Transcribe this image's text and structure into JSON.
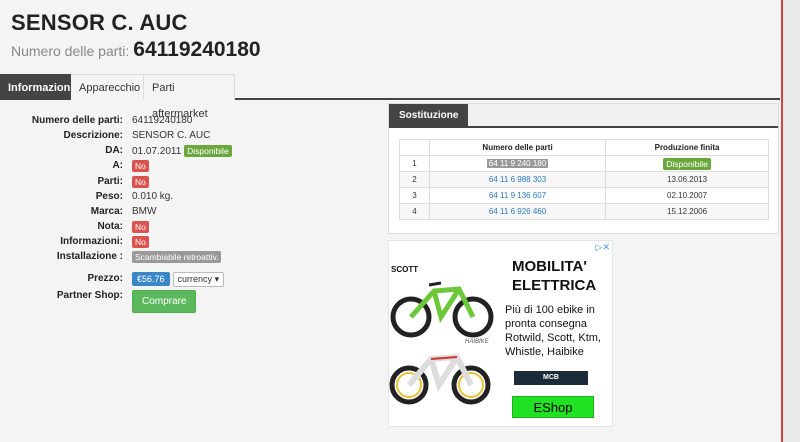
{
  "product": {
    "title": "SENSOR C. AUC",
    "subtitle_label": "Numero delle parti:",
    "subtitle_number": "64119240180"
  },
  "tabs": [
    {
      "label": "Informazioni",
      "active": true
    },
    {
      "label": "Apparecchio",
      "active": false
    },
    {
      "label": "Parti aftermarket",
      "active": false
    }
  ],
  "info": {
    "part_number": {
      "label": "Numero delle parti:",
      "value": "64119240180"
    },
    "description": {
      "label": "Descrizione:",
      "value": "SENSOR C. AUC"
    },
    "from": {
      "label": "DA:",
      "value": "01.07.2011",
      "badge": "Disponibile"
    },
    "a": {
      "label": "A:",
      "badge": "No"
    },
    "parts": {
      "label": "Parti:",
      "badge": "No"
    },
    "weight": {
      "label": "Peso:",
      "value": "0.010 kg."
    },
    "brand": {
      "label": "Marca:",
      "value": "BMW"
    },
    "note": {
      "label": "Nota:",
      "badge": "No"
    },
    "informazioni": {
      "label": "Informazioni:",
      "badge": "No"
    },
    "install": {
      "label": "Installazione :",
      "badge": "Scambiabile retroattiv."
    },
    "price": {
      "label": "Prezzo:",
      "value": "€56.76",
      "currency": "currency"
    },
    "partner": {
      "label": "Partner Shop:",
      "button": "Comprare"
    }
  },
  "substitution": {
    "tab": "Sostituzione",
    "headers": [
      "Numero delle parti",
      "Produzione finita"
    ],
    "rows": [
      {
        "idx": "1",
        "part": "64 11 9 240 180",
        "end": "Disponibile"
      },
      {
        "idx": "2",
        "part": "64 11 6 988 303",
        "end": "13.06.2013"
      },
      {
        "idx": "3",
        "part": "64 11 9 136 607",
        "end": "02.10.2007"
      },
      {
        "idx": "4",
        "part": "64 11 6 926 460",
        "end": "15.12.2006"
      }
    ]
  },
  "ad": {
    "close": "▷✕",
    "brand_top": "SCOTT",
    "brand_bottom": "HAIBIKE",
    "headline_1": "MOBILITA'",
    "headline_2": "ELETTRICA",
    "body_1": "Più di 100 ebike in",
    "body_2": "pronta consegna",
    "body_3": "Rotwild, Scott, Ktm,",
    "body_4": "Whistle, Haibike",
    "shop_logo": "MCB",
    "cta": "EShop"
  },
  "colors": {
    "active_tab": "#444444",
    "available": "#6aa83d",
    "no": "#d9534f",
    "price": "#3a87c8",
    "buy": "#5cb85c",
    "link": "#2a7bbf"
  }
}
